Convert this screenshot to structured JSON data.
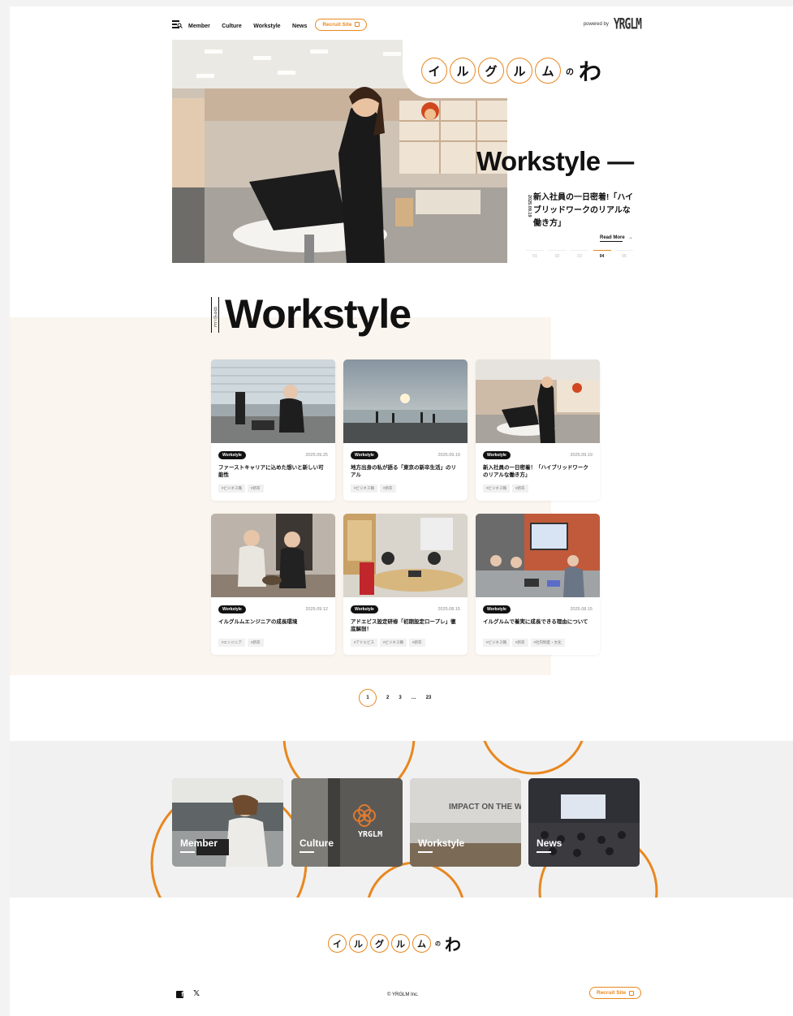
{
  "header": {
    "nav": [
      "Member",
      "Culture",
      "Workstyle",
      "News"
    ],
    "recruit_label": "Recruit Site",
    "powered_by": "powered by",
    "brand": "YRGLM"
  },
  "logo": {
    "chars": [
      "イ",
      "ル",
      "グ",
      "ル",
      "ム"
    ],
    "no": "の",
    "wa": "わ"
  },
  "hero": {
    "category": "Workstyle —",
    "date": "2025.09.19",
    "description": "新入社員の一日密着!「ハイブリッドワークのリアルな働き方」",
    "read_more": "Read More",
    "slides": [
      "01",
      "02",
      "03",
      "04",
      "05"
    ],
    "active_slide": "04"
  },
  "section": {
    "subtitle": "日々のこと",
    "title": "Workstyle"
  },
  "cards": [
    {
      "tag": "Workstyle",
      "date": "2025.09.25",
      "title": "ファーストキャリアに込めた想いと新しい可能性",
      "tags": [
        "#ビジネス職",
        "#新卒"
      ]
    },
    {
      "tag": "Workstyle",
      "date": "2025.09.19",
      "title": "地方出身の私が語る「東京の新卒生活」のリアル",
      "tags": [
        "#ビジネス職",
        "#新卒"
      ]
    },
    {
      "tag": "Workstyle",
      "date": "2025.09.19",
      "title": "新入社員の一日密着！「ハイブリッドワークのリアルな働き方」",
      "tags": [
        "#ビジネス職",
        "#新卒"
      ]
    },
    {
      "tag": "Workstyle",
      "date": "2025.09.12",
      "title": "イルグルムエンジニアの成長環境",
      "tags": [
        "#エンジニア",
        "#新卒"
      ]
    },
    {
      "tag": "Workstyle",
      "date": "2025.08.15",
      "title": "アドエビス設定研修「初期設定ロープレ」徹底解剖！",
      "tags": [
        "#アドエビス",
        "#ビジネス職",
        "#新卒"
      ]
    },
    {
      "tag": "Workstyle",
      "date": "2025.08.15",
      "title": "イルグルムで着実に成長できる理由について",
      "tags": [
        "#ビジネス職",
        "#新卒",
        "#社内制度・文化"
      ]
    }
  ],
  "pagination": [
    "1",
    "2",
    "3",
    "…",
    "23"
  ],
  "categories": [
    "Member",
    "Culture",
    "Workstyle",
    "News"
  ],
  "culture_sign": "YRGLM",
  "impact_text": "IMPACT ON THE WORLD",
  "footer": {
    "copyright": "© YRGLM Inc.",
    "recruit_label": "Recruit Site",
    "x_glyph": "𝕏",
    "fb_glyph": "f"
  },
  "colors": {
    "accent": "#e8871e",
    "beige": "#faf5ef",
    "band": "#f1f1f1"
  }
}
